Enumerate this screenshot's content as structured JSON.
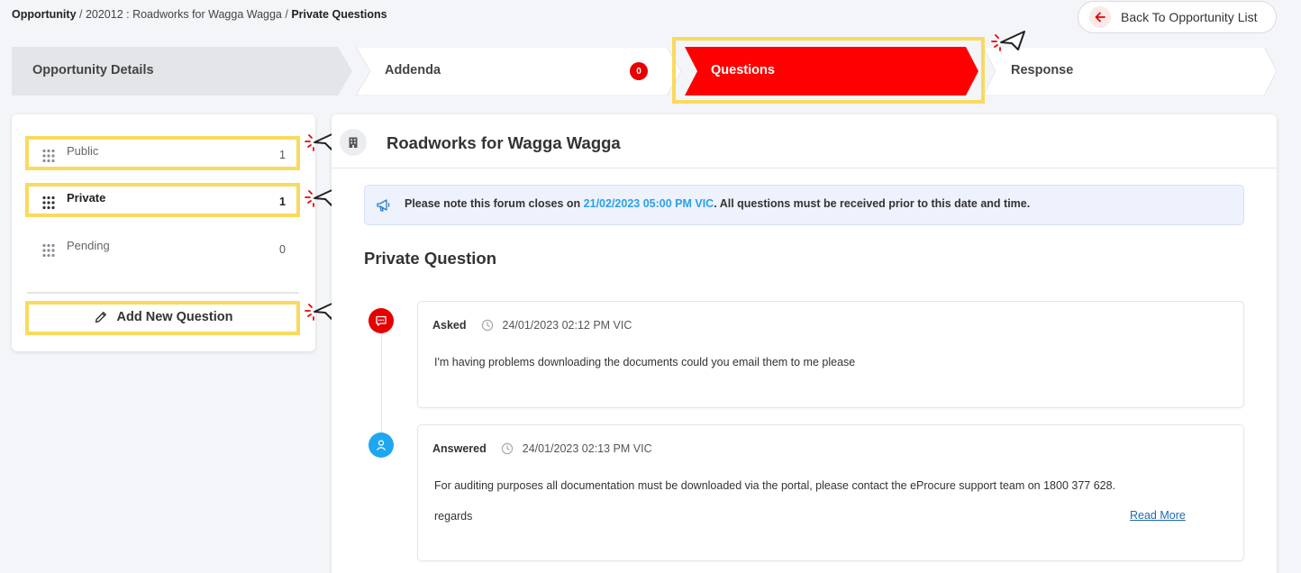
{
  "breadcrumb": {
    "root": "Opportunity",
    "sep1": " / ",
    "middle": "202012 : Roadworks for Wagga Wagga",
    "sep2": " / ",
    "current": "Private Questions"
  },
  "back_button": {
    "label": "Back To Opportunity List"
  },
  "steps": [
    {
      "label": "Opportunity Details",
      "state": "done"
    },
    {
      "label": "Addenda",
      "state": "normal",
      "badge": "0"
    },
    {
      "label": "Questions",
      "state": "active"
    },
    {
      "label": "Response",
      "state": "normal"
    }
  ],
  "categories": [
    {
      "label": "Public",
      "count": "1"
    },
    {
      "label": "Private",
      "count": "1",
      "active": true
    },
    {
      "label": "Pending",
      "count": "0"
    }
  ],
  "add_question": {
    "label": "Add New Question"
  },
  "main": {
    "title": "Roadworks for Wagga Wagga",
    "notice": {
      "prefix": "Please note this forum closes on ",
      "date": "21/02/2023 05:00 PM VIC",
      "suffix": ". All questions must be received prior to this date and time."
    },
    "section_title": "Private Question"
  },
  "thread": [
    {
      "type": "Asked",
      "timestamp": "24/01/2023 02:12 PM VIC",
      "body": [
        "I'm having problems downloading the documents could you email them to me please"
      ]
    },
    {
      "type": "Answered",
      "timestamp": "24/01/2023 02:13 PM VIC",
      "body": [
        "For auditing purposes all documentation must be downloaded via the portal, please contact the eProcure support team on 1800 377 628.",
        "regards"
      ],
      "read_more": "Read More"
    }
  ],
  "colors": {
    "accent_red": "#e60000",
    "highlight_yellow": "#fada5e",
    "link_blue": "#2aa0e8",
    "answer_blue": "#1ea7f0"
  },
  "icons": [
    "arrow-left-icon",
    "building-icon",
    "megaphone-icon",
    "chat-icon",
    "user-icon",
    "clock-icon",
    "pencil-icon",
    "grip-dots-icon",
    "pointer-cursor-icon"
  ]
}
